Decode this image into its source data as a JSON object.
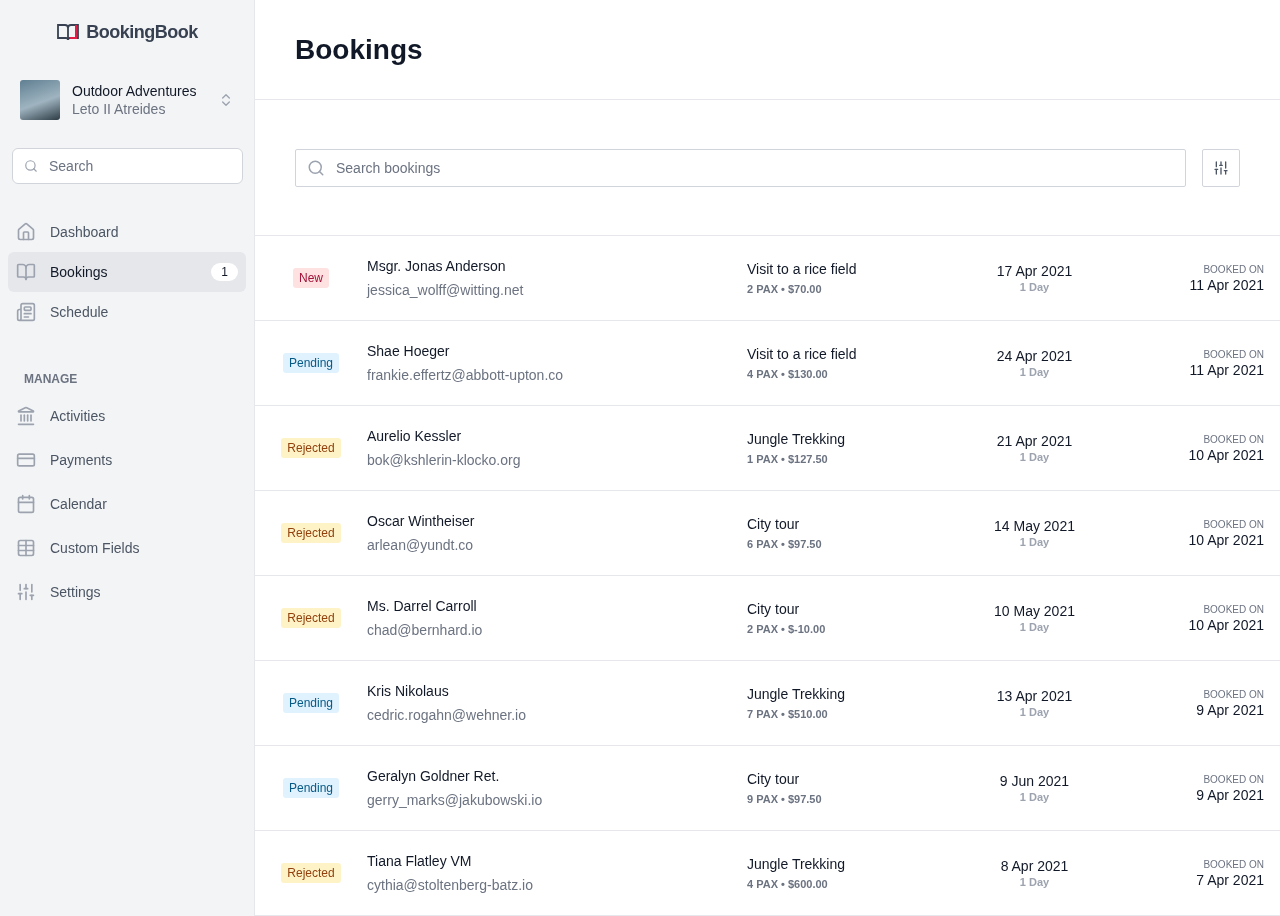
{
  "sidebar": {
    "logo": "BookingBook",
    "account": {
      "name": "Outdoor Adventures",
      "user": "Leto II Atreides"
    },
    "search": {
      "placeholder": "Search"
    },
    "items": [
      {
        "label": "Dashboard",
        "selected": false
      },
      {
        "label": "Bookings",
        "selected": true,
        "badge": "1"
      },
      {
        "label": "Schedule",
        "selected": false
      }
    ],
    "section": "MANAGE",
    "manage_items": [
      {
        "label": "Activities",
        "selected": false
      },
      {
        "label": "Payments",
        "selected": false
      },
      {
        "label": "Calendar",
        "selected": false
      },
      {
        "label": "Custom Fields",
        "selected": false
      },
      {
        "label": "Settings",
        "selected": false
      }
    ]
  },
  "title": "Bookings",
  "search": {
    "placeholder": "Search bookings"
  },
  "bookings": [
    {
      "status": {
        "label": "New",
        "kind": "new"
      },
      "name": "Msgr. Jonas Anderson",
      "email": "jessica_wolff@witting.net",
      "activity": "Visit to a rice field",
      "details": "2 PAX • $70.00",
      "date": "17 Apr 2021",
      "duration": "1 Day",
      "booked_label": "BOOKED ON",
      "booked_on": "11 Apr 2021"
    },
    {
      "status": {
        "label": "Pending",
        "kind": "pending"
      },
      "name": "Shae Hoeger",
      "email": "frankie.effertz@abbott-upton.co",
      "activity": "Visit to a rice field",
      "details": "4 PAX • $130.00",
      "date": "24 Apr 2021",
      "duration": "1 Day",
      "booked_label": "BOOKED ON",
      "booked_on": "11 Apr 2021"
    },
    {
      "status": {
        "label": "Rejected",
        "kind": "rejected"
      },
      "name": "Aurelio Kessler",
      "email": "bok@kshlerin-klocko.org",
      "activity": "Jungle Trekking",
      "details": "1 PAX • $127.50",
      "date": "21 Apr 2021",
      "duration": "1 Day",
      "booked_label": "BOOKED ON",
      "booked_on": "10 Apr 2021"
    },
    {
      "status": {
        "label": "Rejected",
        "kind": "rejected"
      },
      "name": "Oscar Wintheiser",
      "email": "arlean@yundt.co",
      "activity": "City tour",
      "details": "6 PAX • $97.50",
      "date": "14 May 2021",
      "duration": "1 Day",
      "booked_label": "BOOKED ON",
      "booked_on": "10 Apr 2021"
    },
    {
      "status": {
        "label": "Rejected",
        "kind": "rejected"
      },
      "name": "Ms. Darrel Carroll",
      "email": "chad@bernhard.io",
      "activity": "City tour",
      "details": "2 PAX • $-10.00",
      "date": "10 May 2021",
      "duration": "1 Day",
      "booked_label": "BOOKED ON",
      "booked_on": "10 Apr 2021"
    },
    {
      "status": {
        "label": "Pending",
        "kind": "pending"
      },
      "name": "Kris Nikolaus",
      "email": "cedric.rogahn@wehner.io",
      "activity": "Jungle Trekking",
      "details": "7 PAX • $510.00",
      "date": "13 Apr 2021",
      "duration": "1 Day",
      "booked_label": "BOOKED ON",
      "booked_on": "9 Apr 2021"
    },
    {
      "status": {
        "label": "Pending",
        "kind": "pending"
      },
      "name": "Geralyn Goldner Ret.",
      "email": "gerry_marks@jakubowski.io",
      "activity": "City tour",
      "details": "9 PAX • $97.50",
      "date": "9 Jun 2021",
      "duration": "1 Day",
      "booked_label": "BOOKED ON",
      "booked_on": "9 Apr 2021"
    },
    {
      "status": {
        "label": "Rejected",
        "kind": "rejected"
      },
      "name": "Tiana Flatley VM",
      "email": "cythia@stoltenberg-batz.io",
      "activity": "Jungle Trekking",
      "details": "4 PAX • $600.00",
      "date": "8 Apr 2021",
      "duration": "1 Day",
      "booked_label": "BOOKED ON",
      "booked_on": "7 Apr 2021"
    }
  ]
}
